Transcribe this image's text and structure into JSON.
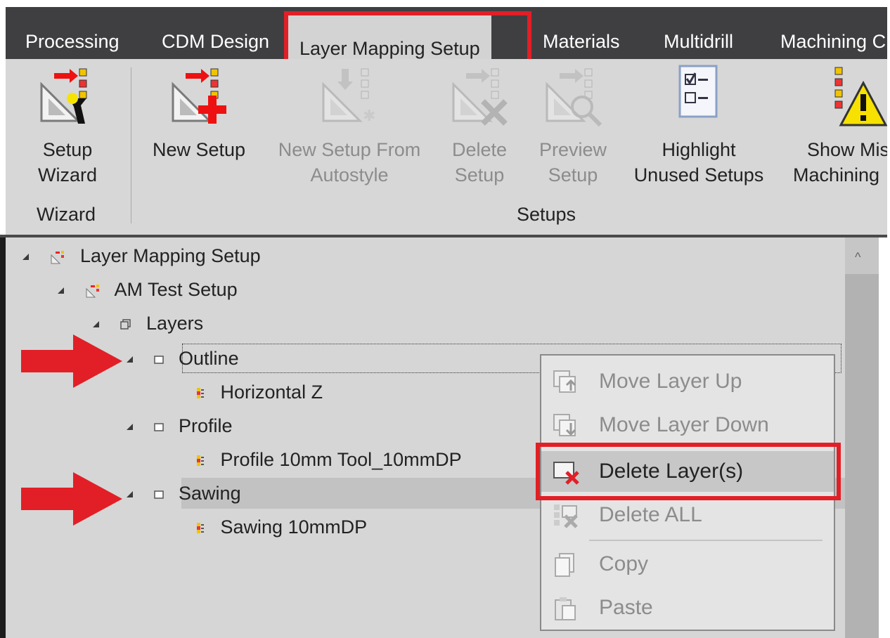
{
  "tabs": [
    {
      "label": "Processing",
      "active": false
    },
    {
      "label": "CDM Design",
      "active": false
    },
    {
      "label": "Layer Mapping Setup",
      "active": true
    },
    {
      "label": "Materials",
      "active": false
    },
    {
      "label": "Multidrill",
      "active": false
    },
    {
      "label": "Machining C",
      "active": false
    }
  ],
  "ribbon": {
    "buttons": [
      {
        "line1": "Setup",
        "line2": "Wizard",
        "enabled": true,
        "icon": "setup-wizard-icon"
      },
      {
        "line1": "New Setup",
        "line2": "",
        "enabled": true,
        "icon": "new-setup-icon"
      },
      {
        "line1": "New Setup From",
        "line2": "Autostyle",
        "enabled": false,
        "icon": "new-setup-autostyle-icon"
      },
      {
        "line1": "Delete",
        "line2": "Setup",
        "enabled": false,
        "icon": "delete-setup-icon"
      },
      {
        "line1": "Preview",
        "line2": "Setup",
        "enabled": false,
        "icon": "preview-setup-icon"
      },
      {
        "line1": "Highlight",
        "line2": "Unused Setups",
        "enabled": true,
        "icon": "checklist-icon"
      },
      {
        "line1": "Show Mis",
        "line2": "Machining",
        "enabled": true,
        "icon": "warning-icon"
      }
    ],
    "groups": {
      "wizard": "Wizard",
      "setups": "Setups"
    }
  },
  "tree": {
    "root": "Layer Mapping Setup",
    "setup": "AM Test Setup",
    "layers_node": "Layers",
    "layers": [
      {
        "name": "Outline",
        "child": "Horizontal Z"
      },
      {
        "name": "Profile",
        "child": "Profile 10mm Tool_10mmDP"
      },
      {
        "name": "Sawing",
        "child": "Sawing 10mmDP"
      }
    ]
  },
  "context_menu": {
    "items": [
      {
        "label": "Move Layer Up",
        "enabled": false,
        "icon": "move-up-icon"
      },
      {
        "label": "Move Layer Down",
        "enabled": false,
        "icon": "move-down-icon"
      },
      {
        "label": "Delete Layer(s)",
        "enabled": true,
        "icon": "delete-layer-icon"
      },
      {
        "label": "Delete ALL",
        "enabled": false,
        "icon": "delete-all-icon"
      },
      {
        "label": "Copy",
        "enabled": false,
        "icon": "copy-icon"
      },
      {
        "label": "Paste",
        "enabled": false,
        "icon": "paste-icon"
      }
    ]
  },
  "colors": {
    "annotation_red": "#e21f26",
    "tab_bar": "#3f3f42",
    "ribbon_bg": "#d7d7d7"
  }
}
